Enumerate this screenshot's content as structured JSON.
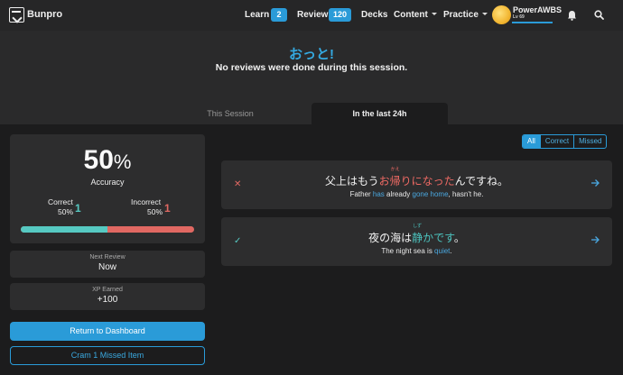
{
  "nav": {
    "brand": "Bunpro",
    "learn_label": "Learn",
    "learn_count": "2",
    "review_label": "Review",
    "review_count": "120",
    "decks_label": "Decks",
    "content_label": "Content",
    "practice_label": "Practice",
    "username": "PowerAWBS",
    "level": "Lv 69",
    "icons": [
      "bunpro-logo-icon",
      "bell-icon",
      "search-icon"
    ]
  },
  "hero": {
    "title": "おっと!",
    "subtitle": "No reviews were done during this session.",
    "tabs": [
      {
        "label": "This Session",
        "active": false
      },
      {
        "label": "In the last 24h",
        "active": true
      }
    ]
  },
  "summary": {
    "accuracy_value": "50",
    "accuracy_unit": "%",
    "accuracy_label": "Accuracy",
    "correct_label": "Correct",
    "correct_percent": "50%",
    "correct_count": "1",
    "incorrect_label": "Incorrect",
    "incorrect_percent": "50%",
    "incorrect_count": "1",
    "correct_fraction": 0.5
  },
  "next_review": {
    "label": "Next Review",
    "value": "Now"
  },
  "xp": {
    "label": "XP Earned",
    "value": "+100"
  },
  "buttons": {
    "dashboard": "Return to Dashboard",
    "cram": "Cram 1 Missed Item"
  },
  "filter": {
    "all": "All",
    "correct": "Correct",
    "missed": "Missed",
    "selected": "All"
  },
  "reviews": [
    {
      "status": "incorrect",
      "status_icon": "✕",
      "jp_before": "父上はもう",
      "jp_furi_base": "お帰",
      "jp_furi_reading": "かえ",
      "jp_highlight_rest": "りになった",
      "jp_after": "んですね。",
      "en_before": "Father ",
      "en_hl1": "has",
      "en_mid1": " already ",
      "en_hl2": "gone home",
      "en_after": ", hasn't he."
    },
    {
      "status": "correct",
      "status_icon": "✓",
      "jp_before": "夜の海は",
      "jp_furi_base": "静",
      "jp_furi_reading": "しず",
      "jp_highlight_rest": "かです",
      "jp_after": "。",
      "en_before": "The night sea is ",
      "en_hl1": "quiet",
      "en_after": "."
    }
  ],
  "colors": {
    "accent": "#2a9bd8",
    "correct": "#56c9c2",
    "incorrect": "#e06862"
  }
}
